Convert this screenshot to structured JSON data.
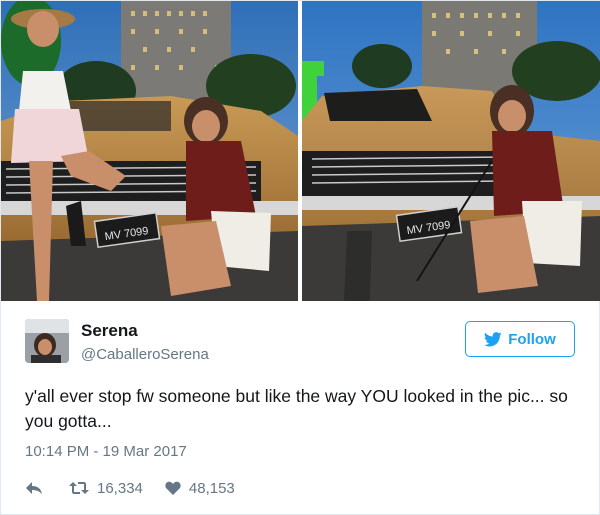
{
  "tweet": {
    "display_name": "Serena",
    "handle": "@CaballeroSerena",
    "text": "y'all ever stop fw someone but like the way YOU looked in the pic... so you gotta...",
    "timestamp": "10:14 PM - 19 Mar 2017",
    "follow_label": "Follow",
    "retweet_count": "16,334",
    "like_count": "48,153"
  },
  "photos": {
    "left_plate": "MV 7099",
    "right_plate": "MV 7099"
  },
  "icons": {
    "follow": "twitter-bird-icon",
    "reply": "reply-arrow-icon",
    "retweet": "retweet-icon",
    "like": "heart-icon"
  },
  "colors": {
    "twitter_blue": "#1da1f2",
    "text_primary": "#14171a",
    "text_secondary": "#657786",
    "border": "#e1e8ed"
  }
}
